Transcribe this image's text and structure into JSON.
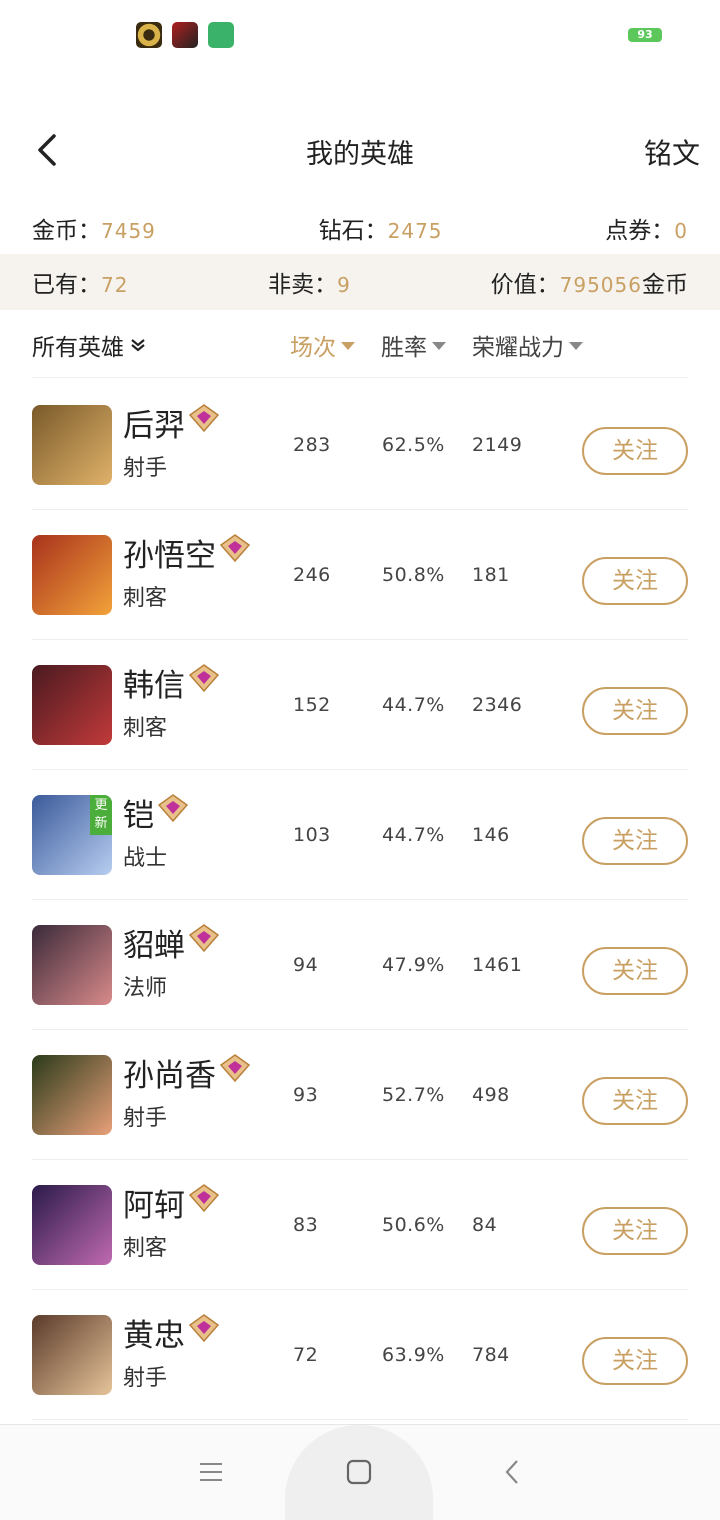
{
  "status": {
    "battery": "93"
  },
  "header": {
    "title": "我的英雄",
    "right_label": "铭文"
  },
  "currency": {
    "gold_label": "金币：",
    "gold": "7459",
    "diamond_label": "钻石：",
    "diamond": "2475",
    "voucher_label": "点券：",
    "voucher": "0"
  },
  "stats": {
    "owned_label": "已有：",
    "owned": "72",
    "nonsale_label": "非卖：",
    "nonsale": "9",
    "value_label": "价值：",
    "value": "795056",
    "value_unit": "金币"
  },
  "sort": {
    "filter": "所有英雄",
    "matches": "场次",
    "winrate": "胜率",
    "power": "荣耀战力"
  },
  "follow_label": "关注",
  "update_badge": "更新",
  "heroes": [
    {
      "name": "后羿",
      "role": "射手",
      "matches": "283",
      "winrate": "62.5%",
      "power": "2149",
      "colors": [
        "#7a5a2a",
        "#e0b26a"
      ]
    },
    {
      "name": "孙悟空",
      "role": "刺客",
      "matches": "246",
      "winrate": "50.8%",
      "power": "181",
      "colors": [
        "#a8321c",
        "#f2a23a"
      ]
    },
    {
      "name": "韩信",
      "role": "刺客",
      "matches": "152",
      "winrate": "44.7%",
      "power": "2346",
      "colors": [
        "#4a1a20",
        "#c23a3a"
      ]
    },
    {
      "name": "铠",
      "role": "战士",
      "matches": "103",
      "winrate": "44.7%",
      "power": "146",
      "colors": [
        "#3b5a9a",
        "#b7cdf0"
      ]
    },
    {
      "name": "貂蝉",
      "role": "法师",
      "matches": "94",
      "winrate": "47.9%",
      "power": "1461",
      "colors": [
        "#3a2a3a",
        "#d98a8a"
      ]
    },
    {
      "name": "孙尚香",
      "role": "射手",
      "matches": "93",
      "winrate": "52.7%",
      "power": "498",
      "colors": [
        "#2a3a1a",
        "#e8a07a"
      ]
    },
    {
      "name": "阿轲",
      "role": "刺客",
      "matches": "83",
      "winrate": "50.6%",
      "power": "84",
      "colors": [
        "#2a1a4a",
        "#c06ab0"
      ]
    },
    {
      "name": "黄忠",
      "role": "射手",
      "matches": "72",
      "winrate": "63.9%",
      "power": "784",
      "colors": [
        "#5a3a2a",
        "#e6c49a"
      ]
    }
  ]
}
